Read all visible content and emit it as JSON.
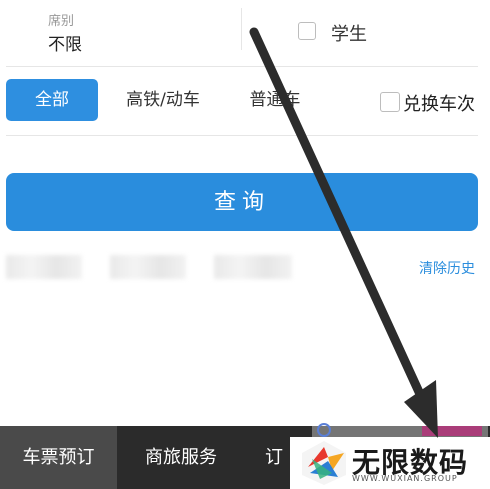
{
  "seat": {
    "label": "席别",
    "value": "不限"
  },
  "student": {
    "label": "学生"
  },
  "filters": {
    "tabs": [
      {
        "label": "全部",
        "active": true
      },
      {
        "label": "高铁/动车",
        "active": false
      },
      {
        "label": "普通车",
        "active": false
      }
    ],
    "transfer_label": "兑换车次"
  },
  "query_button": "查询",
  "history": {
    "clear_label": "清除历史"
  },
  "bottom_nav": [
    {
      "label": "车票预订",
      "active": true
    },
    {
      "label": "商旅服务",
      "active": false
    },
    {
      "label": "订",
      "active": false
    }
  ],
  "watermark": {
    "title": "无限数码",
    "subtitle": "WWW.WUXIAN.GROUP"
  },
  "colors": {
    "accent": "#2a8ddd",
    "nav_bg": "#2b2b2b",
    "arrow": "#2c2c2c"
  }
}
